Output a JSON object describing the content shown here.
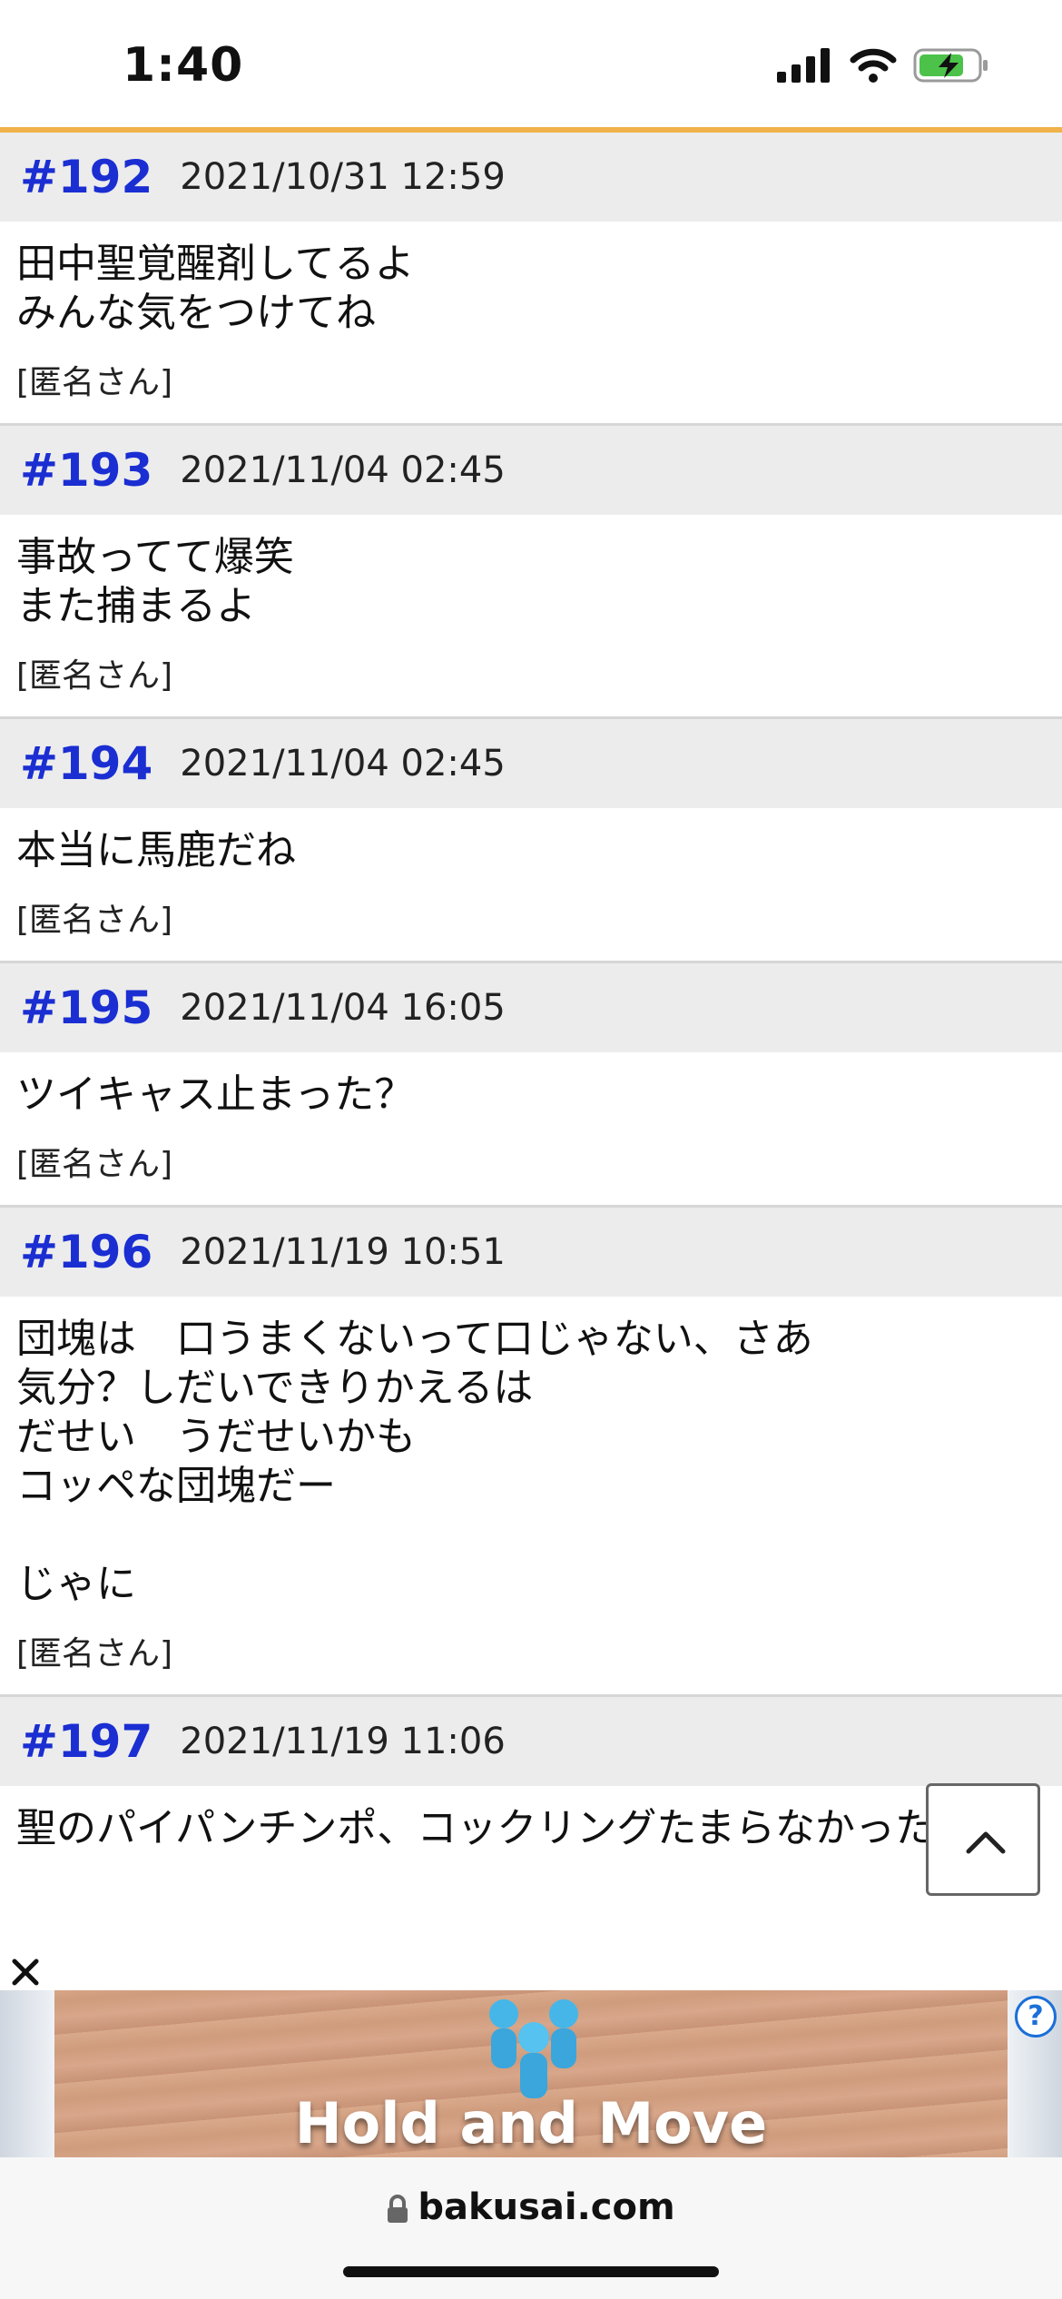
{
  "status_bar": {
    "time": "1:40"
  },
  "posts": [
    {
      "num": "#192",
      "date": "2021/10/31 12:59",
      "text": "田中聖覚醒剤してるよ\nみんな気をつけてね",
      "author": "[匿名さん]"
    },
    {
      "num": "#193",
      "date": "2021/11/04 02:45",
      "text": "事故ってて爆笑\nまた捕まるよ",
      "author": "[匿名さん]"
    },
    {
      "num": "#194",
      "date": "2021/11/04 02:45",
      "text": "本当に馬鹿だね\n ",
      "author": "[匿名さん]"
    },
    {
      "num": "#195",
      "date": "2021/11/04 16:05",
      "text": "ツイキャス止まった？\n ",
      "author": "[匿名さん]"
    },
    {
      "num": "#196",
      "date": "2021/11/19 10:51",
      "text": "団塊は　口うまくないって口じゃない、さあ\n気分？しだいできりかえるは\nだせい　うだせいかも\nコッペな団塊だー\n \nじゃに",
      "author": "[匿名さん]"
    },
    {
      "num": "#197",
      "date": "2021/11/19 11:06",
      "text": "聖のパイパンチンポ、コックリングたまらなかった"
    }
  ],
  "ad": {
    "text": "Hold and Move",
    "help": "?"
  },
  "browser": {
    "url": "bakusai.com"
  },
  "colors": {
    "accent_line": "#f0b24a",
    "post_number": "#1a2ed2",
    "header_bg": "#ececec"
  }
}
